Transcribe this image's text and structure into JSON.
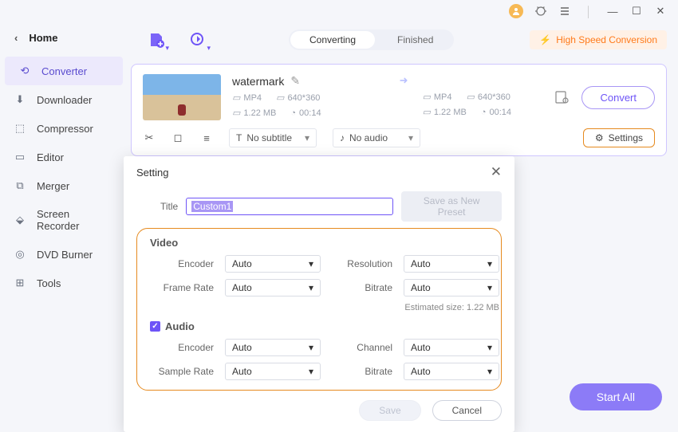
{
  "titlebar": {
    "min": "—",
    "max": "▢",
    "close": "✕"
  },
  "home": {
    "label": "Home"
  },
  "sidebar": {
    "items": [
      {
        "label": "Converter"
      },
      {
        "label": "Downloader"
      },
      {
        "label": "Compressor"
      },
      {
        "label": "Editor"
      },
      {
        "label": "Merger"
      },
      {
        "label": "Screen Recorder"
      },
      {
        "label": "DVD Burner"
      },
      {
        "label": "Tools"
      }
    ]
  },
  "tabs": {
    "a": "Converting",
    "b": "Finished"
  },
  "hispeed": {
    "label": "High Speed Conversion"
  },
  "file": {
    "name": "watermark",
    "src": {
      "fmt": "MP4",
      "res": "640*360",
      "size": "1.22 MB",
      "dur": "00:14"
    },
    "dst": {
      "fmt": "MP4",
      "res": "640*360",
      "size": "1.22 MB",
      "dur": "00:14"
    },
    "convert": "Convert",
    "subtitle": "No subtitle",
    "audio": "No audio",
    "settings": "Settings"
  },
  "start": "Start All",
  "modal": {
    "title": "Setting",
    "titleLbl": "Title",
    "titleVal": "Custom1",
    "preset": "Save as New Preset",
    "video": {
      "heading": "Video",
      "encoder": "Encoder",
      "enc": "Auto",
      "resolution": "Resolution",
      "res": "Auto",
      "framerate": "Frame Rate",
      "fr": "Auto",
      "bitrate": "Bitrate",
      "br": "Auto",
      "est": "Estimated size: 1.22 MB"
    },
    "audio": {
      "heading": "Audio",
      "encoder": "Encoder",
      "enc": "Auto",
      "channel": "Channel",
      "ch": "Auto",
      "samplerate": "Sample Rate",
      "sr": "Auto",
      "bitrate": "Bitrate",
      "br": "Auto"
    },
    "save": "Save",
    "cancel": "Cancel"
  }
}
